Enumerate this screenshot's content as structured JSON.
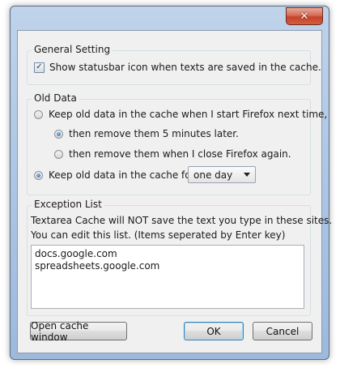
{
  "window": {
    "close_label": "✕"
  },
  "general": {
    "legend": "General Setting",
    "show_statusbar": {
      "label": "Show statusbar icon when texts are saved in the cache.",
      "checked": true
    }
  },
  "old_data": {
    "legend": "Old Data",
    "keep_until_restart": {
      "label": "Keep old data in the cache when I start Firefox next time,",
      "selected": false
    },
    "remove_5min": {
      "label": "then remove them 5 minutes later.",
      "selected": true
    },
    "remove_on_close": {
      "label": "then remove them when I close Firefox again.",
      "selected": false
    },
    "keep_for": {
      "label": "Keep old data in the cache for",
      "selected": true
    },
    "duration": {
      "value": "one day"
    }
  },
  "exceptions": {
    "legend": "Exception List",
    "description_line1": "Textarea Cache will NOT save the text you type in these sites.",
    "description_line2": "You can edit this list. (Items seperated by Enter key)",
    "sites": [
      "docs.google.com",
      "spreadsheets.google.com"
    ]
  },
  "buttons": {
    "open_cache": "Open cache window",
    "ok": "OK",
    "cancel": "Cancel"
  },
  "colors": {
    "accent": "#1f5fa8",
    "close_button": "#c2442b"
  }
}
